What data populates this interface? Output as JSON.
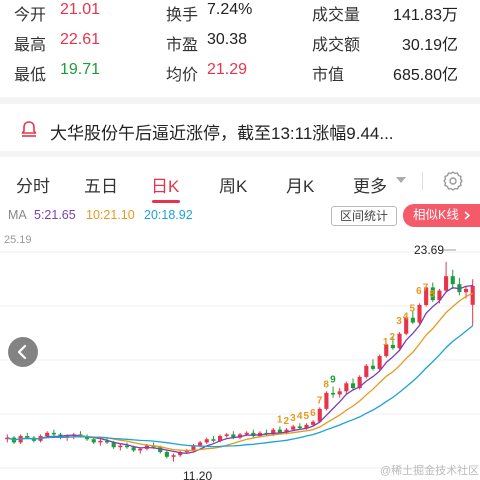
{
  "stats": {
    "rows": [
      [
        {
          "label": "今开",
          "value": "21.01",
          "tone": "up"
        },
        {
          "label": "换手",
          "value": "7.24%",
          "tone": "dark"
        },
        {
          "label": "成交量",
          "value": "141.83万",
          "tone": "dark"
        }
      ],
      [
        {
          "label": "最高",
          "value": "22.61",
          "tone": "up"
        },
        {
          "label": "市盈",
          "value": "30.38",
          "tone": "dark"
        },
        {
          "label": "成交额",
          "value": "30.19亿",
          "tone": "dark"
        }
      ],
      [
        {
          "label": "最低",
          "value": "19.71",
          "tone": "down"
        },
        {
          "label": "均价",
          "value": "21.29",
          "tone": "up"
        },
        {
          "label": "市值",
          "value": "685.80亿",
          "tone": "dark"
        }
      ]
    ]
  },
  "news": {
    "icon": "bell-icon",
    "text": "大华股份午后逼近涨停，截至13:11涨幅9.44..."
  },
  "tabs": {
    "items": [
      "分时",
      "五日",
      "日K",
      "周K",
      "月K",
      "更多"
    ],
    "active": "日K"
  },
  "ma": {
    "label": "MA",
    "ma5": "5:21.65",
    "ma10": "10:21.10",
    "ma20": "20:18.92",
    "stat_button": "区间统计",
    "similar_button": "相似K线"
  },
  "chart_data": {
    "type": "candlestick",
    "y_top_label": "25.19",
    "high_label": "23.69",
    "low_label": "11.20",
    "colors": {
      "up": "#e8344a",
      "down": "#1a9e3a",
      "ma5": "#7b3fb5",
      "ma10": "#e69a1d",
      "ma20": "#1ba3d9"
    },
    "sequence_markers_low": [
      "1",
      "2",
      "3",
      "4",
      "5",
      "6",
      "7",
      "8",
      "9"
    ],
    "sequence_markers_high": [
      "1",
      "2",
      "3",
      "4",
      "5",
      "6",
      "7",
      "8"
    ],
    "candles": [
      [
        12.6,
        12.9,
        12.4,
        12.7
      ],
      [
        12.7,
        12.8,
        12.3,
        12.4
      ],
      [
        12.4,
        12.9,
        12.3,
        12.8
      ],
      [
        12.8,
        13.0,
        12.6,
        12.7
      ],
      [
        12.7,
        12.8,
        12.4,
        12.5
      ],
      [
        12.5,
        12.9,
        12.4,
        12.8
      ],
      [
        12.8,
        13.1,
        12.7,
        13.0
      ],
      [
        13.0,
        13.2,
        12.8,
        12.9
      ],
      [
        12.9,
        13.0,
        12.6,
        12.7
      ],
      [
        12.7,
        12.9,
        12.5,
        12.8
      ],
      [
        12.8,
        13.0,
        12.6,
        12.9
      ],
      [
        12.9,
        13.1,
        12.7,
        12.8
      ],
      [
        12.8,
        12.9,
        12.5,
        12.6
      ],
      [
        12.6,
        12.7,
        12.3,
        12.4
      ],
      [
        12.4,
        12.6,
        12.2,
        12.5
      ],
      [
        12.5,
        12.7,
        12.3,
        12.4
      ],
      [
        12.4,
        12.5,
        12.0,
        12.1
      ],
      [
        12.1,
        12.3,
        11.9,
        12.2
      ],
      [
        12.2,
        12.4,
        12.0,
        12.1
      ],
      [
        12.1,
        12.2,
        11.8,
        11.9
      ],
      [
        11.9,
        12.1,
        11.7,
        12.0
      ],
      [
        12.0,
        12.3,
        11.9,
        12.2
      ],
      [
        12.2,
        12.4,
        12.0,
        12.1
      ],
      [
        12.1,
        12.2,
        11.7,
        11.8
      ],
      [
        11.8,
        11.9,
        11.4,
        11.5
      ],
      [
        11.5,
        11.7,
        11.2,
        11.6
      ],
      [
        11.6,
        11.9,
        11.5,
        11.8
      ],
      [
        11.8,
        12.0,
        11.7,
        11.9
      ],
      [
        11.9,
        12.3,
        11.8,
        12.2
      ],
      [
        12.2,
        12.5,
        12.1,
        12.4
      ],
      [
        12.4,
        12.7,
        12.3,
        12.6
      ],
      [
        12.6,
        12.8,
        12.4,
        12.5
      ],
      [
        12.5,
        12.9,
        12.4,
        12.8
      ],
      [
        12.8,
        13.0,
        12.7,
        12.9
      ],
      [
        12.9,
        13.1,
        12.6,
        12.7
      ],
      [
        12.7,
        13.0,
        12.6,
        12.9
      ],
      [
        12.9,
        13.1,
        12.8,
        13.0
      ],
      [
        13.0,
        13.2,
        12.7,
        12.8
      ],
      [
        12.8,
        13.1,
        12.7,
        13.0
      ],
      [
        13.0,
        13.2,
        12.8,
        12.9
      ],
      [
        12.9,
        13.3,
        12.8,
        13.2
      ],
      [
        13.2,
        13.4,
        12.9,
        13.0
      ],
      [
        13.0,
        13.3,
        12.9,
        13.2
      ],
      [
        13.2,
        13.5,
        13.1,
        13.4
      ],
      [
        13.4,
        13.6,
        13.2,
        13.3
      ],
      [
        13.3,
        13.6,
        13.2,
        13.5
      ],
      [
        13.5,
        13.8,
        13.4,
        13.7
      ],
      [
        13.7,
        14.6,
        13.6,
        14.5
      ],
      [
        14.5,
        15.6,
        14.4,
        15.5
      ],
      [
        15.5,
        15.9,
        15.2,
        15.4
      ],
      [
        15.4,
        15.8,
        15.2,
        15.6
      ],
      [
        15.6,
        16.2,
        15.4,
        16.1
      ],
      [
        16.1,
        16.4,
        15.7,
        15.8
      ],
      [
        15.8,
        16.6,
        15.7,
        16.5
      ],
      [
        16.5,
        17.3,
        16.4,
        17.2
      ],
      [
        17.2,
        17.6,
        16.9,
        17.0
      ],
      [
        17.0,
        17.9,
        16.9,
        17.8
      ],
      [
        17.8,
        18.6,
        17.7,
        18.5
      ],
      [
        18.5,
        19.0,
        18.2,
        18.3
      ],
      [
        18.3,
        19.3,
        18.2,
        19.2
      ],
      [
        19.2,
        20.3,
        19.1,
        20.2
      ],
      [
        20.2,
        20.6,
        19.8,
        19.9
      ],
      [
        19.9,
        21.1,
        19.8,
        21.0
      ],
      [
        21.0,
        22.2,
        20.9,
        22.1
      ],
      [
        22.1,
        22.4,
        21.2,
        21.3
      ],
      [
        21.3,
        22.0,
        21.1,
        21.9
      ],
      [
        21.9,
        23.69,
        21.8,
        22.8
      ],
      [
        22.8,
        23.2,
        22.0,
        22.3
      ],
      [
        22.3,
        22.7,
        21.6,
        21.8
      ],
      [
        21.8,
        22.2,
        21.4,
        22.0
      ],
      [
        21.01,
        22.61,
        19.71,
        22.2
      ]
    ]
  },
  "watermark": "@稀土掘金技术社区"
}
